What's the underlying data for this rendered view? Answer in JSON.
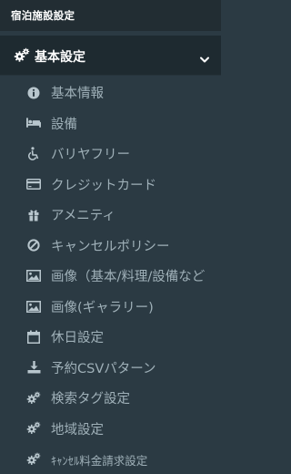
{
  "section_title": "宿泊施設設定",
  "group": {
    "label": "基本設定",
    "icon": "gears-icon",
    "expanded": true
  },
  "menu_items": [
    {
      "label": "基本情報",
      "icon": "info-circle-icon"
    },
    {
      "label": "設備",
      "icon": "bed-icon"
    },
    {
      "label": "バリヤフリー",
      "icon": "wheelchair-icon"
    },
    {
      "label": "クレジットカード",
      "icon": "credit-card-icon"
    },
    {
      "label": "アメニティ",
      "icon": "gift-icon"
    },
    {
      "label": "キャンセルポリシー",
      "icon": "ban-icon"
    },
    {
      "label": "画像（基本/料理/設備など",
      "icon": "image-icon"
    },
    {
      "label": "画像(ギャラリー)",
      "icon": "image-icon"
    },
    {
      "label": "休日設定",
      "icon": "calendar-icon"
    },
    {
      "label": "予約CSVパターン",
      "icon": "download-icon"
    },
    {
      "label": "検索タグ設定",
      "icon": "gears-icon"
    },
    {
      "label": "地域設定",
      "icon": "gears-icon"
    },
    {
      "label": "ｷｬﾝｾﾙ料金請求設定",
      "icon": "gears-icon"
    }
  ],
  "colors": {
    "background": "#2b3a43",
    "header": "#1e2a30",
    "item_text": "#9fb0b8",
    "item_icon": "#b8c6cd"
  }
}
